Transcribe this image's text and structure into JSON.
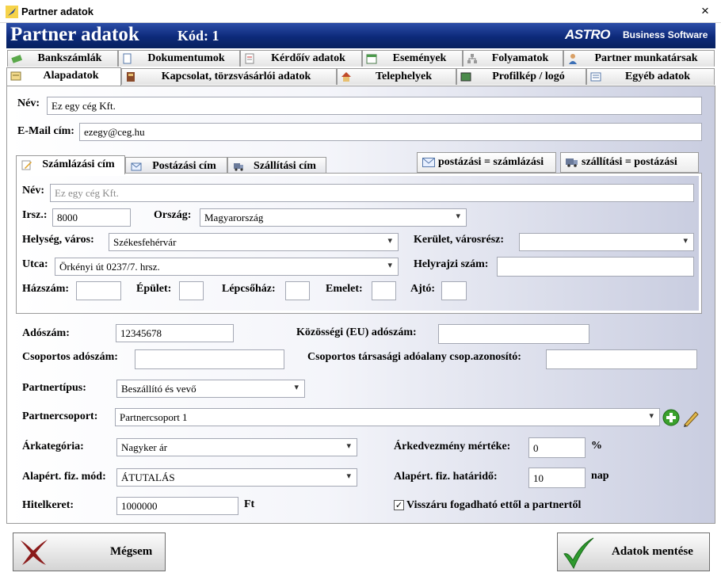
{
  "window": {
    "title": "Partner adatok",
    "close_glyph": "×"
  },
  "banner": {
    "title": "Partner adatok",
    "code": "Kód: 1",
    "brand": "ASTRO",
    "brand_sub": "Business Software"
  },
  "tabs_row1": [
    {
      "label": "Bankszámlák",
      "icon": "money-icon"
    },
    {
      "label": "Dokumentumok",
      "icon": "document-icon"
    },
    {
      "label": "Kérdőív adatok",
      "icon": "survey-icon"
    },
    {
      "label": "Események",
      "icon": "calendar-icon"
    },
    {
      "label": "Folyamatok",
      "icon": "process-icon"
    },
    {
      "label": "Partner munkatársak",
      "icon": "person-icon"
    }
  ],
  "tabs_row2": [
    {
      "label": "Alapadatok",
      "icon": "card-icon",
      "active": true
    },
    {
      "label": "Kapcsolat, törzsvásárlói adatok",
      "icon": "book-icon"
    },
    {
      "label": "Telephelyek",
      "icon": "home-icon"
    },
    {
      "label": "Profilkép / logó",
      "icon": "picture-icon"
    },
    {
      "label": "Egyéb adatok",
      "icon": "list-icon"
    }
  ],
  "form": {
    "nev_label": "Név:",
    "nev_value": "Ez egy cég Kft.",
    "email_label": "E-Mail cím:",
    "email_value": "ezegy@ceg.hu"
  },
  "address_tabs": [
    {
      "label": "Számlázási cím",
      "icon": "pencil-icon",
      "active": true
    },
    {
      "label": "Postázási cím",
      "icon": "envelope-icon"
    },
    {
      "label": "Szállítási cím",
      "icon": "truck-icon"
    }
  ],
  "copy_buttons": {
    "post": "postázási = számlázási",
    "ship": "szállítási = postázási"
  },
  "address": {
    "nev_label": "Név:",
    "nev_value": "Ez egy cég Kft.",
    "irsz_label": "Irsz.:",
    "irsz_value": "8000",
    "orszag_label": "Ország:",
    "orszag_value": "Magyarország",
    "helyseg_label": "Helység, város:",
    "helyseg_value": "Székesfehérvár",
    "kerulet_label": "Kerület, városrész:",
    "kerulet_value": "",
    "utca_label": "Utca:",
    "utca_value": "Örkényi út 0237/7. hrsz.",
    "hrsz_label": "Helyrajzi szám:",
    "hrsz_value": "",
    "hazszam_label": "Házszám:",
    "epulet_label": "Épület:",
    "lepcsohaz_label": "Lépcsőház:",
    "emelet_label": "Emelet:",
    "ajto_label": "Ajtó:"
  },
  "tax": {
    "adoszam_label": "Adószám:",
    "adoszam_value": "12345678",
    "eu_label": "Közösségi (EU) adószám:",
    "eu_value": "",
    "csop_label": "Csoportos adószám:",
    "csop_value": "",
    "csop_id_label": "Csoportos társasági adóalany csop.azonosító:",
    "csop_id_value": ""
  },
  "partner": {
    "tipus_label": "Partnertípus:",
    "tipus_value": "Beszállító és vevő",
    "csoport_label": "Partnercsoport:",
    "csoport_value": "Partnercsoport 1",
    "arkat_label": "Árkategória:",
    "arkat_value": "Nagyker ár",
    "kedv_label": "Árkedvezmény mértéke:",
    "kedv_value": "0",
    "kedv_unit": "%",
    "fizmod_label": "Alapért. fiz. mód:",
    "fizmod_value": "ÁTUTALÁS",
    "hatarido_label": "Alapért. fiz. határidő:",
    "hatarido_value": "10",
    "hatarido_unit": "nap",
    "hitel_label": "Hitelkeret:",
    "hitel_value": "1000000",
    "hitel_unit": "Ft",
    "visszaru_label": "Visszáru fogadható ettől a partnertől",
    "visszaru_checked": true
  },
  "buttons": {
    "cancel": "Mégsem",
    "save": "Adatok mentése"
  },
  "colors": {
    "banner": "#0d2a7a",
    "save_check": "#2e9a2e",
    "cancel_x": "#8b1a1a",
    "add_green": "#3aa02c"
  }
}
